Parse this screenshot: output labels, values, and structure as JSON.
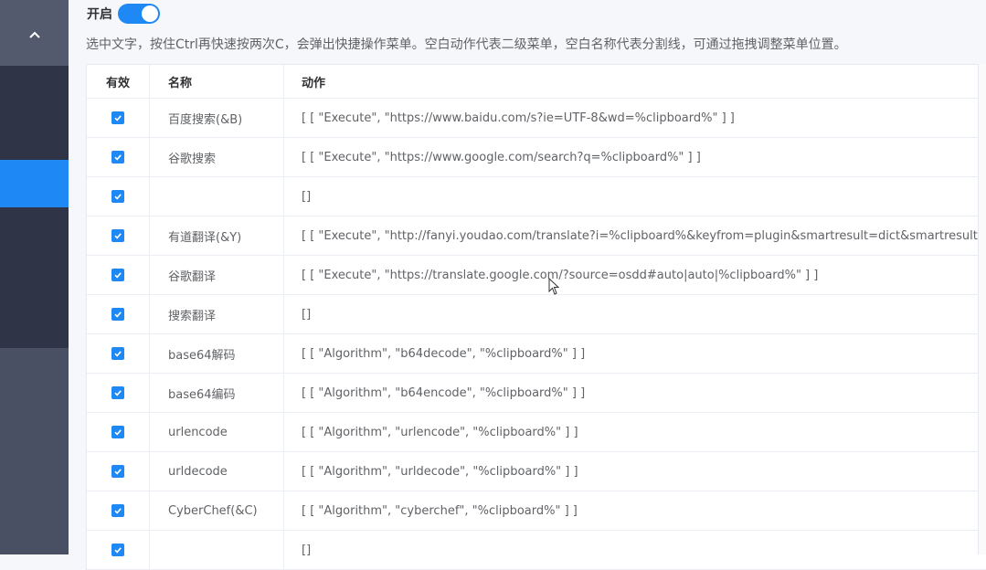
{
  "header": {
    "switch_label": "开启",
    "hint": "选中文字，按住Ctrl再快速按两次C，会弹出快捷操作菜单。空白动作代表二级菜单，空白名称代表分割线，可通过拖拽调整菜单位置。"
  },
  "table": {
    "columns": [
      "有效",
      "名称",
      "动作"
    ],
    "rows": [
      {
        "valid": true,
        "name": "百度搜索(&B)",
        "action": "[ [ \"Execute\", \"https://www.baidu.com/s?ie=UTF-8&wd=%clipboard%\" ] ]"
      },
      {
        "valid": true,
        "name": "谷歌搜索",
        "action": "[ [ \"Execute\", \"https://www.google.com/search?q=%clipboard%\" ] ]"
      },
      {
        "valid": true,
        "name": "",
        "action": "[]"
      },
      {
        "valid": true,
        "name": "有道翻译(&Y)",
        "action": "[ [ \"Execute\", \"http://fanyi.youdao.com/translate?i=%clipboard%&keyfrom=plugin&smartresult=dict&smartresult=rule\" ] ]"
      },
      {
        "valid": true,
        "name": "谷歌翻译",
        "action": "[ [ \"Execute\", \"https://translate.google.com/?source=osdd#auto|auto|%clipboard%\" ] ]"
      },
      {
        "valid": true,
        "name": "搜索翻译",
        "action": "[]"
      },
      {
        "valid": true,
        "name": "base64解码",
        "action": "[ [ \"Algorithm\", \"b64decode\", \"%clipboard%\" ] ]"
      },
      {
        "valid": true,
        "name": "base64编码",
        "action": "[ [ \"Algorithm\", \"b64encode\", \"%clipboard%\" ] ]"
      },
      {
        "valid": true,
        "name": "urlencode",
        "action": "[ [ \"Algorithm\", \"urlencode\", \"%clipboard%\" ] ]"
      },
      {
        "valid": true,
        "name": "urldecode",
        "action": "[ [ \"Algorithm\", \"urldecode\", \"%clipboard%\" ] ]"
      },
      {
        "valid": true,
        "name": "CyberChef(&C)",
        "action": "[ [ \"Algorithm\", \"cyberchef\", \"%clipboard%\" ] ]"
      },
      {
        "valid": true,
        "name": "",
        "action": "[]"
      }
    ]
  },
  "colors": {
    "accent": "#1e88f4",
    "sidebar": "#4a5064",
    "sidebar_dark": "#2f3447"
  },
  "icons": [
    "chevron-up-icon",
    "checkbox-checked-icon",
    "mouse-cursor-icon"
  ]
}
